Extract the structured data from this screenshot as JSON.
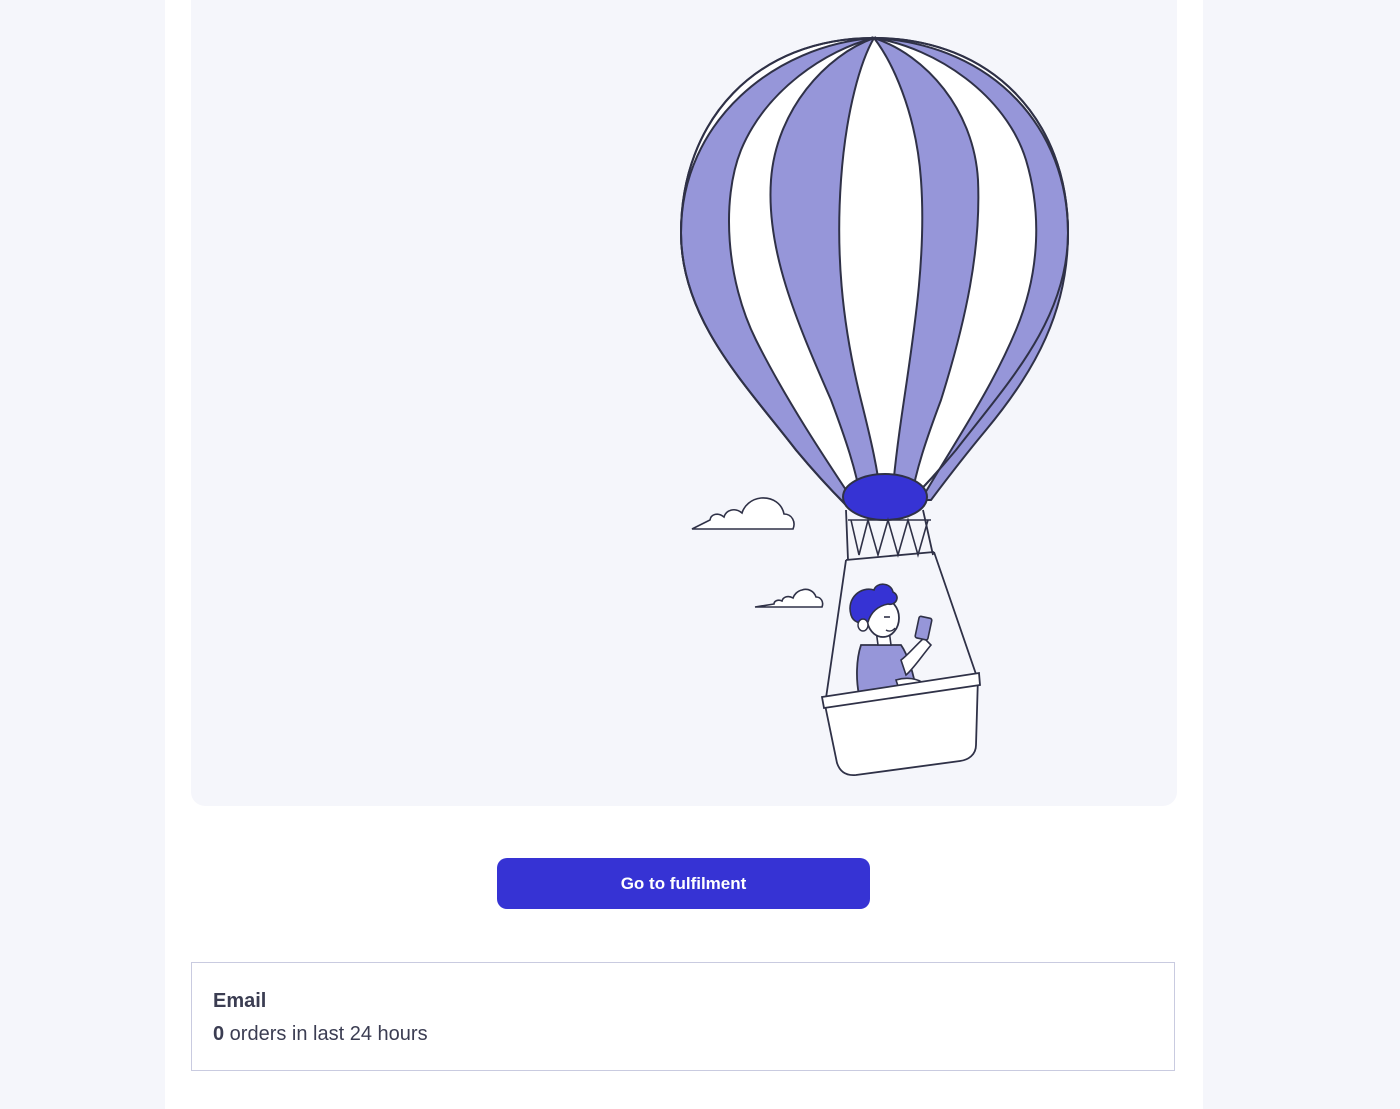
{
  "colors": {
    "background": "#f5f6fb",
    "card": "#ffffff",
    "accent": "#3633d4",
    "balloon_stripe": "#9696d9",
    "outline": "#2f3147",
    "text": "#3b3d52"
  },
  "illustration": {
    "icon": "hot-air-balloon-illustration"
  },
  "cta": {
    "label": "Go to fulfilment"
  },
  "channel": {
    "title": "Email",
    "order_count": "0",
    "order_suffix": " orders in last 24 hours"
  }
}
